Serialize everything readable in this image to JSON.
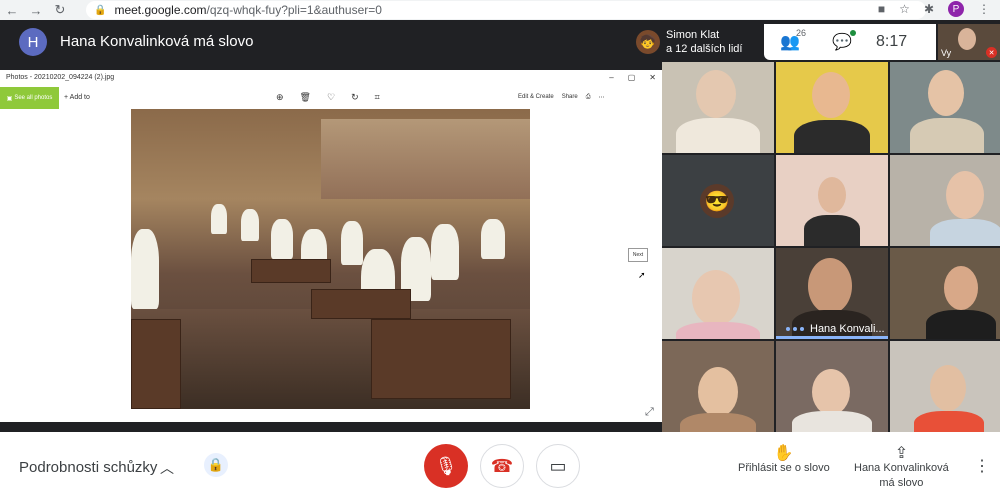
{
  "browser": {
    "url_host": "meet.google.com",
    "url_path": "/qzq-whqk-fuy?pli=1&authuser=0",
    "profile_initial": "P"
  },
  "meet": {
    "speaker_avatar_initial": "H",
    "speaker_text": "Hana Konvalinková má slovo",
    "people_pill": {
      "name": "Simon Klat",
      "others": "a 12 dalších lidí"
    },
    "participant_count": "26",
    "clock": "8:17",
    "self_label": "Vy"
  },
  "shared_window": {
    "title": "Photos - 20210202_094224 (2).jpg",
    "see_all_label": "See all photos",
    "add_to_label": "Add to",
    "edit_create_label": "Edit & Create",
    "share_label": "Share",
    "next_label": "Next"
  },
  "grid": {
    "active_speaker_label": "Hana Konvali..."
  },
  "bottom_bar": {
    "details_label": "Podrobnosti schůzky",
    "raise_hand_label": "Přihlásit se o slovo",
    "presenter_line1": "Hana Konvalinková",
    "presenter_line2": "má slovo"
  },
  "colors": {
    "accent_red": "#d93025",
    "photos_green": "#8fc93a",
    "active_blue": "#8ab4f8"
  }
}
